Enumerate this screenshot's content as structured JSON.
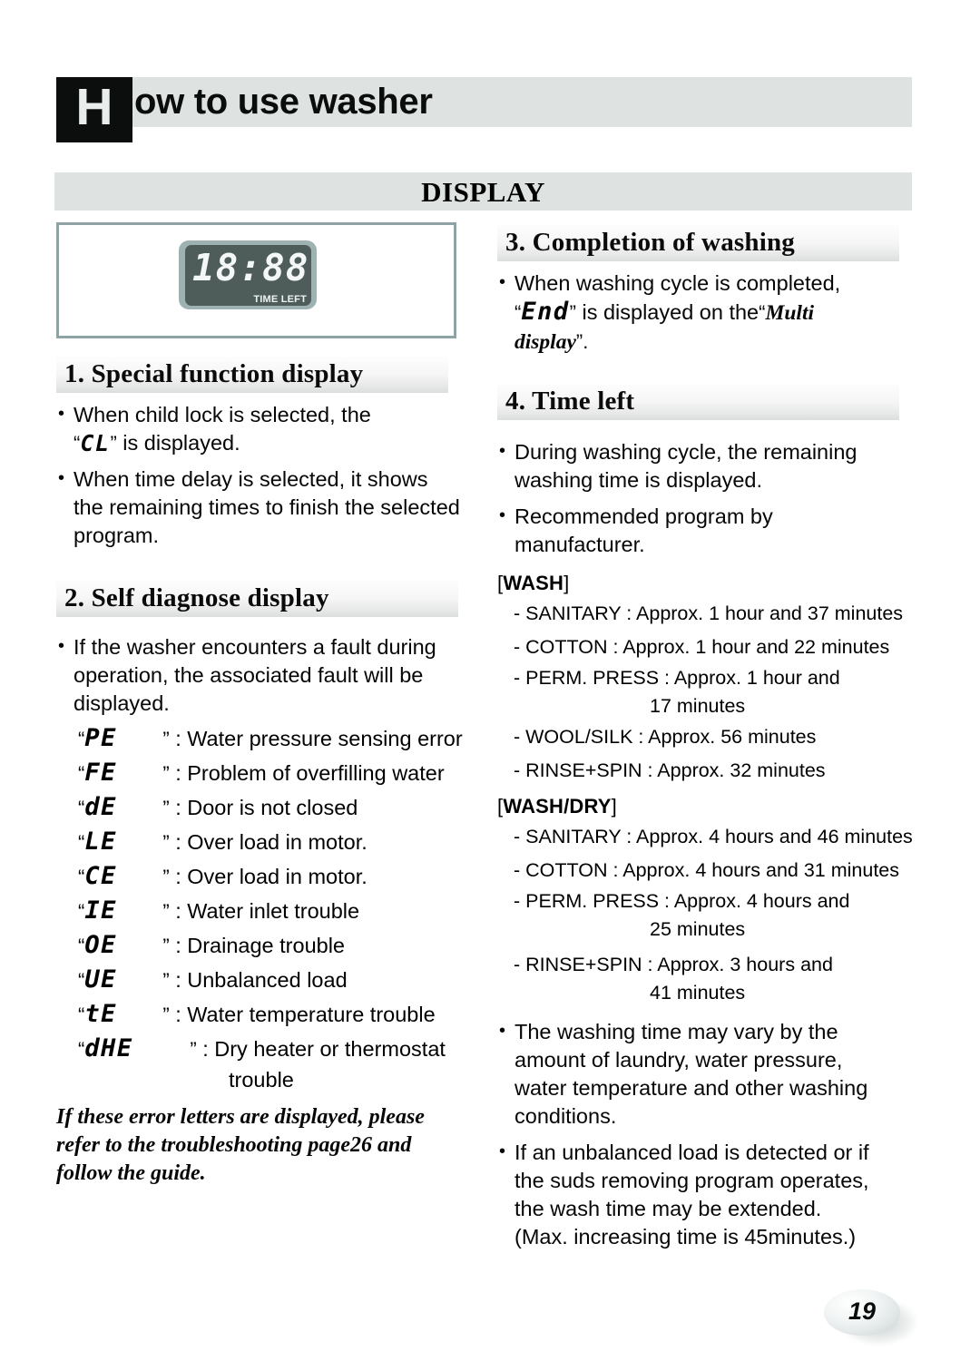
{
  "header": {
    "dropcap": "H",
    "title": "ow to use washer",
    "band_title": "DISPLAY"
  },
  "lcd": {
    "digits": "18:88",
    "caption": "TIME LEFT"
  },
  "sections": {
    "s1": {
      "heading": "1. Special function display",
      "b1_a": "When child lock is selected, the",
      "b1_quote_open": "“",
      "b1_code": "CL",
      "b1_quote_close": "”",
      "b1_b": "is displayed.",
      "b2_l1": "When time delay is selected, it shows",
      "b2_l2": "the remaining times to finish the selected",
      "b2_l3": "program."
    },
    "s2": {
      "heading": "2. Self diagnose display",
      "b1_l1": "If the washer encounters a fault during",
      "b1_l2": "operation, the associated fault will be",
      "b1_l3": "displayed.",
      "errors": [
        {
          "code": "PE",
          "desc": ": Water pressure sensing error"
        },
        {
          "code": "FE",
          "desc": ": Problem of overfilling water"
        },
        {
          "code": "dE",
          "desc": ": Door is not closed"
        },
        {
          "code": "LE",
          "desc": ": Over load in motor."
        },
        {
          "code": "CE",
          "desc": ": Over load in motor."
        },
        {
          "code": "IE",
          "desc": ": Water inlet trouble"
        },
        {
          "code": "OE",
          "desc": ": Drainage trouble"
        },
        {
          "code": "UE",
          "desc": ": Unbalanced load"
        },
        {
          "code": "tE",
          "desc": ": Water temperature trouble"
        },
        {
          "code": "dHE",
          "desc": ": Dry heater or thermostat"
        }
      ],
      "error_cont": "trouble",
      "note_l1": "If these error letters are displayed, please",
      "note_l2": "refer to the troubleshooting page26 and",
      "note_l3": "follow the guide."
    },
    "s3": {
      "heading": "3. Completion of washing",
      "b1_a": "When washing cycle is completed,",
      "b1_quote_open": "“",
      "b1_code": "End",
      "b1_quote_close": "”",
      "b1_b": "is displayed on the",
      "b1_multi_open": "“",
      "b1_multi": "Multi",
      "b1_display": "display",
      "b1_multi_close": "”."
    },
    "s4": {
      "heading": "4. Time left",
      "b1_l1": "During washing cycle, the remaining",
      "b1_l2": "washing time is displayed.",
      "b2_l1": "Recommended program by",
      "b2_l2": "manufacturer.",
      "wash_label_open": "[",
      "wash_label": "WASH",
      "wash_label_close": "]",
      "wash_rows": [
        {
          "text": "- SANITARY : Approx. 1 hour and 37 minutes",
          "cont": ""
        },
        {
          "text": "- COTTON : Approx. 1 hour and 22 minutes",
          "cont": ""
        },
        {
          "text": "- PERM. PRESS : Approx. 1 hour and",
          "cont": "17 minutes"
        },
        {
          "text": "- WOOL/SILK : Approx. 56 minutes",
          "cont": ""
        },
        {
          "text": "- RINSE+SPIN : Approx. 32 minutes",
          "cont": ""
        }
      ],
      "washdry_label_open": "[",
      "washdry_label": "WASH/DRY",
      "washdry_label_close": "]",
      "washdry_rows": [
        {
          "text": "- SANITARY : Approx. 4 hours and 46 minutes",
          "cont": ""
        },
        {
          "text": "- COTTON : Approx. 4 hours and 31 minutes",
          "cont": ""
        },
        {
          "text": "- PERM. PRESS : Approx. 4 hours and",
          "cont": "25 minutes"
        },
        {
          "text": "- RINSE+SPIN : Approx. 3 hours and",
          "cont": "41 minutes"
        }
      ],
      "b3_l1": "The washing time may vary  by the",
      "b3_l2": "amount of laundry, water pressure,",
      "b3_l3": "water temperature and other washing",
      "b3_l4": "conditions.",
      "b4_l1": "If an unbalanced load is detected or if",
      "b4_l2": "the suds removing program operates,",
      "b4_l3": "the wash time may be extended.",
      "b4_l4": "(Max. increasing time is 45minutes.)"
    }
  },
  "footer": {
    "page_number": "19"
  }
}
